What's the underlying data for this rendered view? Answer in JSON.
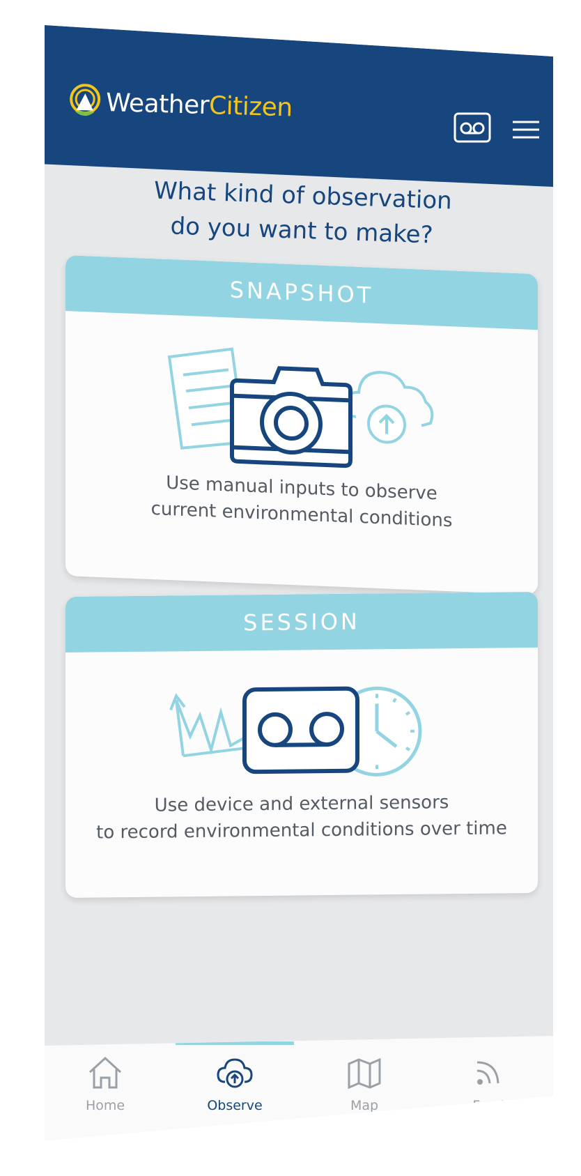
{
  "app": {
    "logo_part1": "Weather",
    "logo_part2": "Citizen",
    "colors": {
      "primary": "#16467d",
      "accent": "#92d4e2",
      "logo_yellow": "#f3c41a",
      "background": "#e7e8ea"
    }
  },
  "header": {
    "record_icon": "voicemail-icon",
    "menu_icon": "hamburger-menu-icon"
  },
  "question": {
    "line1": "What kind of observation",
    "line2": "do you want to make?"
  },
  "cards": [
    {
      "title": "SNAPSHOT",
      "icons": [
        "document-icon",
        "camera-icon",
        "cloud-upload-icon"
      ],
      "desc_line1": "Use manual inputs to observe",
      "desc_line2": "current environmental conditions"
    },
    {
      "title": "SESSION",
      "icons": [
        "trend-graph-icon",
        "voicemail-icon",
        "clock-icon"
      ],
      "desc_line1": "Use device and external sensors",
      "desc_line2": "to record environmental conditions over time"
    }
  ],
  "tabs": [
    {
      "label": "Home",
      "icon": "home-icon",
      "active": false
    },
    {
      "label": "Observe",
      "icon": "cloud-upload-icon",
      "active": true
    },
    {
      "label": "Map",
      "icon": "map-icon",
      "active": false
    },
    {
      "label": "Feed",
      "icon": "rss-feed-icon",
      "active": false
    }
  ]
}
